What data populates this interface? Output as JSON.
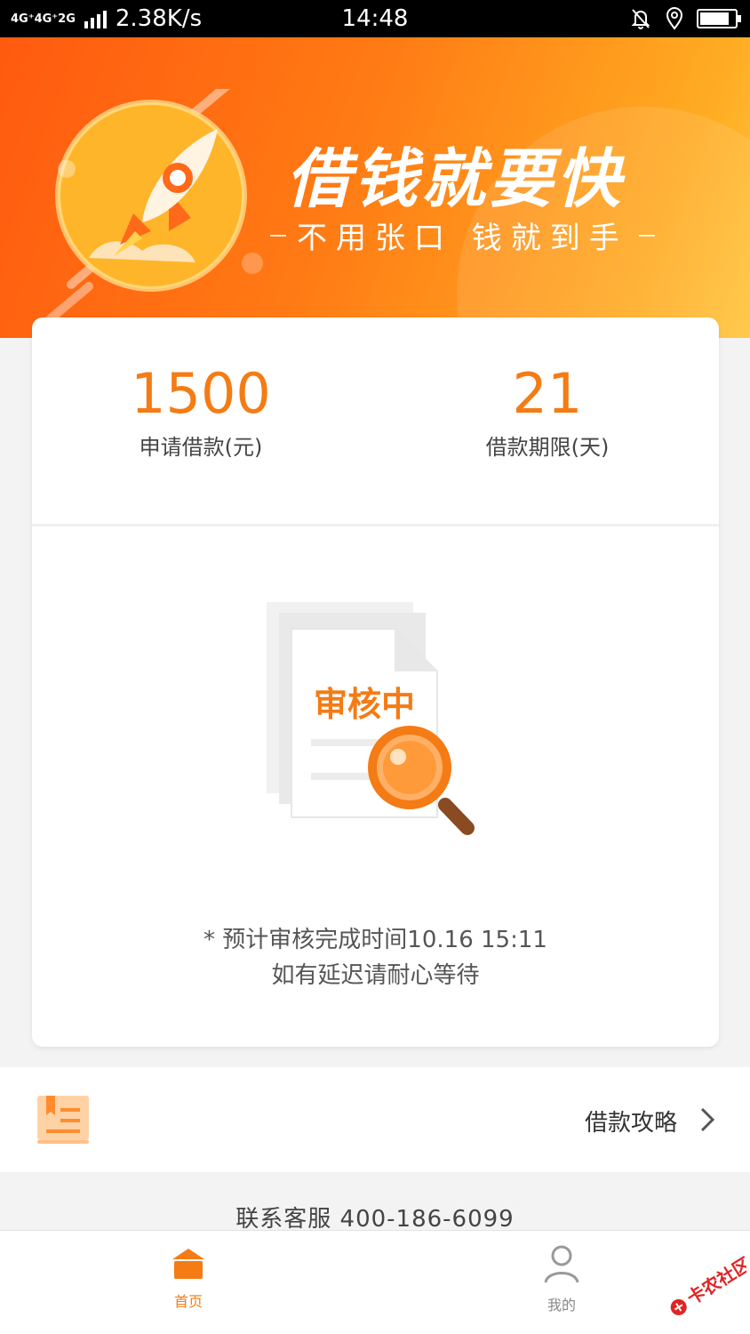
{
  "status_bar": {
    "network": "4G⁺4G⁺2G",
    "speed": "2.38K/s",
    "time": "14:48",
    "battery_level": 0.85
  },
  "banner": {
    "title": "借钱就要快",
    "subtitle": "不用张口 钱就到手"
  },
  "loan": {
    "amount": "1500",
    "amount_label": "申请借款(元)",
    "term": "21",
    "term_label": "借款期限(天)"
  },
  "review": {
    "status": "审核中",
    "estimate": "* 预计审核完成时间10.16 15:11",
    "wait_note": "如有延迟请耐心等待"
  },
  "guide": {
    "label": "借款攻略"
  },
  "contact": {
    "text": "联系客服 400-186-6099"
  },
  "tabs": {
    "home": "首页",
    "mine": "我的"
  },
  "watermark": {
    "text": "卡农社区"
  },
  "colors": {
    "accent": "#f57b14",
    "banner_start": "#ff5a0f",
    "banner_end": "#ffc43a"
  }
}
